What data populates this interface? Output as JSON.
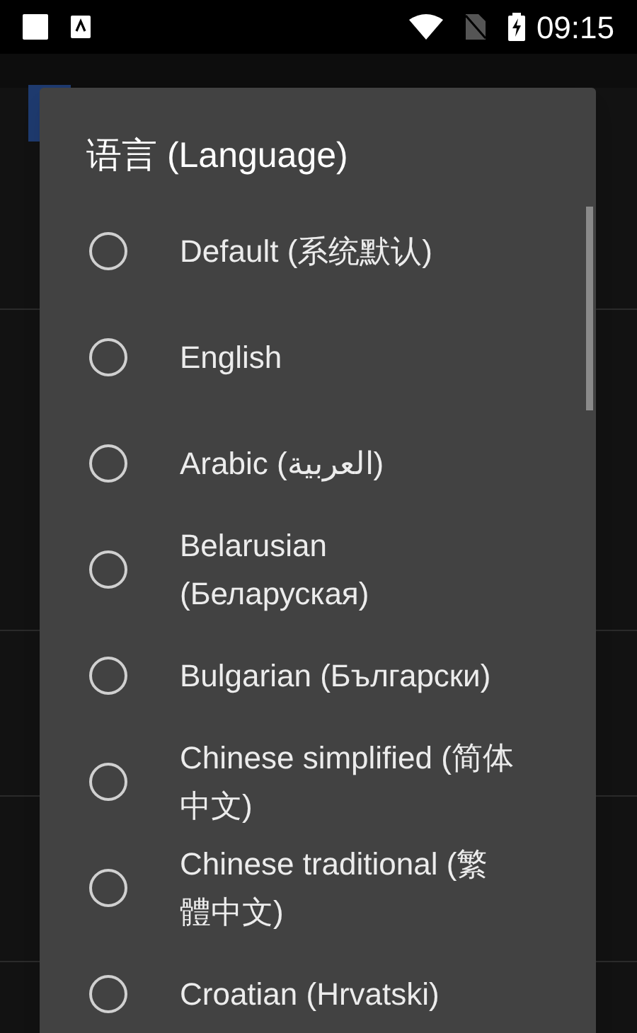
{
  "status_bar": {
    "time": "09:15"
  },
  "dialog": {
    "title": "语言 (Language)",
    "options": [
      {
        "label": "Default (系统默认)",
        "selected": false
      },
      {
        "label": "English",
        "selected": false
      },
      {
        "label": "Arabic (العربية)",
        "selected": false
      },
      {
        "label": "Belarusian (Беларуская)",
        "selected": false
      },
      {
        "label": "Bulgarian (Български)",
        "selected": false
      },
      {
        "label": "Chinese simplified (简体中文)",
        "selected": false
      },
      {
        "label": "Chinese traditional (繁體中文)",
        "selected": false
      },
      {
        "label": "Croatian (Hrvatski)",
        "selected": false
      }
    ]
  }
}
